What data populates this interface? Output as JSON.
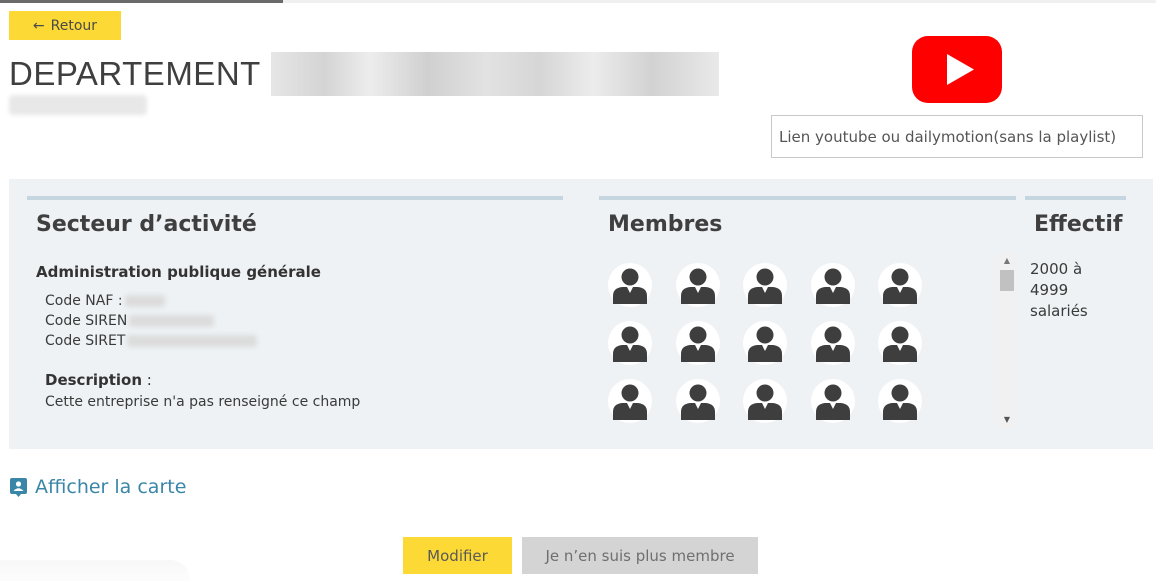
{
  "nav": {
    "back_label": "Retour",
    "back_icon": "arrow-left-icon"
  },
  "header": {
    "title": "DEPARTEMENT"
  },
  "video": {
    "icon": "youtube-icon",
    "brand_color": "#ff0000",
    "placeholder": "Lien youtube ou dailymotion(sans la playlist)"
  },
  "sector": {
    "heading": "Secteur d’activité",
    "name": "Administration publique générale",
    "codes": [
      {
        "label": "Code NAF :"
      },
      {
        "label": "Code SIREN"
      },
      {
        "label": "Code SIRET"
      }
    ],
    "description_label": "Description",
    "description_colon": " :",
    "description_text": "Cette entreprise n'a pas renseigné ce champ"
  },
  "members": {
    "heading": "Membres",
    "count_visible": 15,
    "avatar_icon": "user-avatar-icon"
  },
  "effectif": {
    "heading": "Effectif",
    "value_lines": [
      "2000 à",
      "4999",
      "salariés"
    ]
  },
  "map": {
    "label": "Afficher la carte",
    "icon": "contact-card-icon",
    "color": "#3a86a8"
  },
  "actions": {
    "modify_label": "Modifier",
    "leave_label": "Je n’en suis plus membre",
    "accent_color": "#fcd934"
  }
}
